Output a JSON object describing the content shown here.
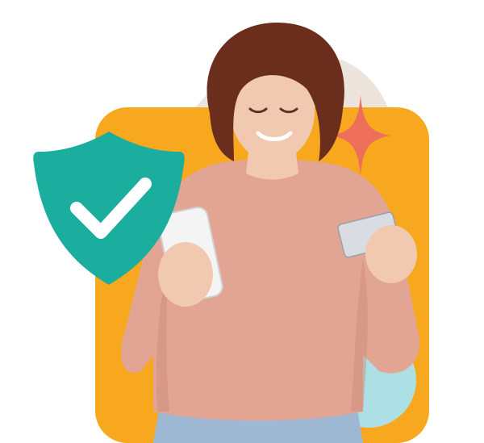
{
  "colors": {
    "orange": "#F8A81E",
    "cream": "#EDE5DC",
    "teal_circle": "#ADE0E4",
    "sparkle": "#EE6E5C",
    "shield": "#1BAE9E",
    "check": "#FFFFFF",
    "sweater": "#E2A593",
    "sweater_shadow": "#C98A78",
    "hair": "#6B2E1C",
    "skin": "#F1C8B0",
    "jeans": "#9EB7D3",
    "phone": "#F4F4F4",
    "card": "#D9DCE3"
  },
  "icons": {
    "shield": "shield-check-icon",
    "sparkle": "sparkle-star-icon"
  }
}
